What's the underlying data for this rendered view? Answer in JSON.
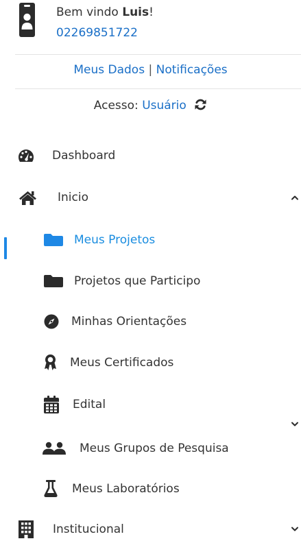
{
  "user": {
    "greeting_prefix": "Bem vindo",
    "name": "Luis",
    "greeting_suffix": "!",
    "id_number": "02269851722"
  },
  "account_links": {
    "my_data": "Meus Dados",
    "separator": "|",
    "notifications": "Notificações"
  },
  "access": {
    "label": "Acesso:",
    "role": "Usuário"
  },
  "menu": {
    "dashboard": "Dashboard",
    "inicio": "Inicio",
    "meus_projetos": "Meus Projetos",
    "projetos_participo": "Projetos que Participo",
    "minhas_orientacoes": "Minhas Orientações",
    "meus_certificados": "Meus Certificados",
    "edital": "Edital",
    "meus_grupos": "Meus Grupos de Pesquisa",
    "meus_laboratorios": "Meus Laboratórios",
    "institucional": "Institucional"
  },
  "colors": {
    "accent": "#1e88e5",
    "text": "#333333",
    "icon": "#2b2b2b"
  }
}
